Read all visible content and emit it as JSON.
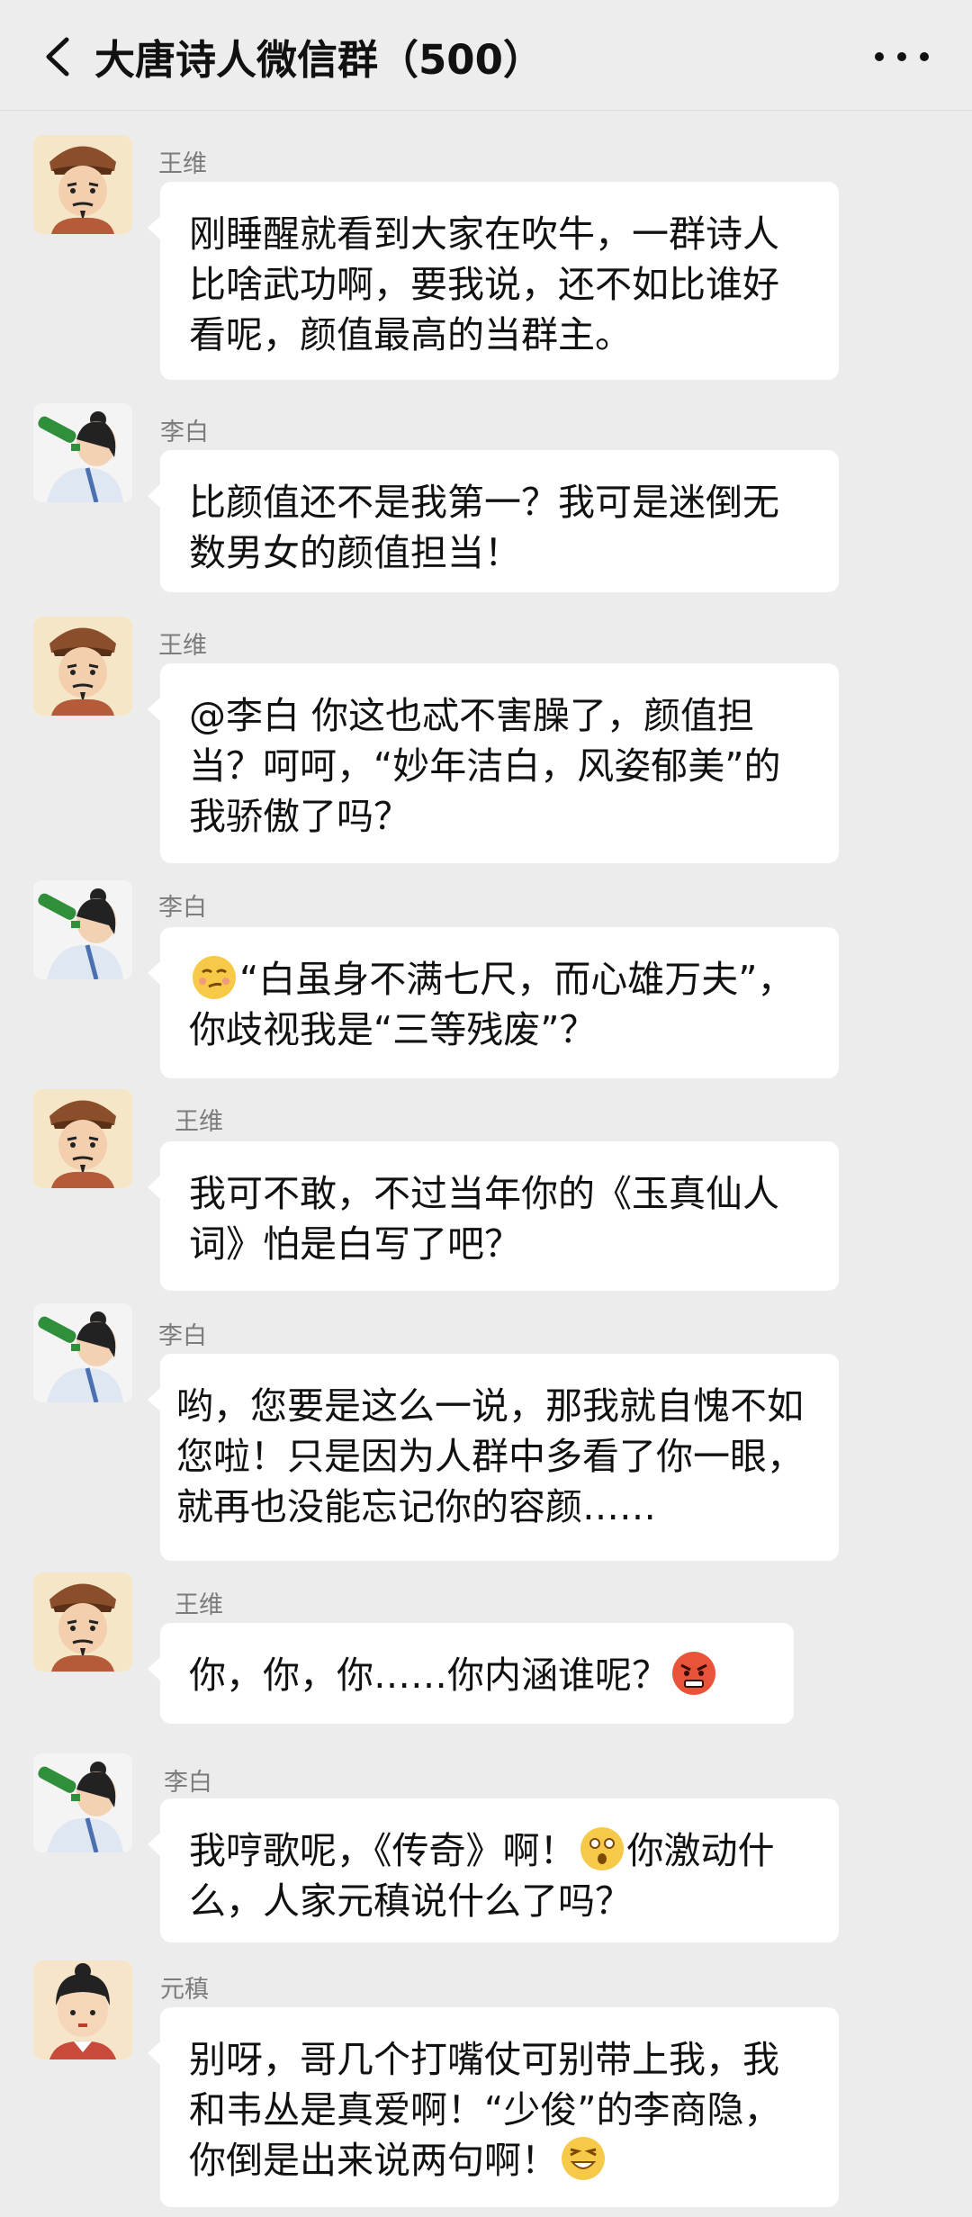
{
  "header": {
    "title": "大唐诗人微信群（500）"
  },
  "messages": [
    {
      "sender": "王维",
      "avatar": "wangwei-avatar",
      "text": "刚睡醒就看到大家在吹牛，一群诗人比啥武功啊，要我说，还不如比谁好看呢，颜值最高的当群主。"
    },
    {
      "sender": "李白",
      "avatar": "libai-avatar",
      "text": "比颜值还不是我第一？我可是迷倒无数男女的颜值担当！"
    },
    {
      "sender": "王维",
      "avatar": "wangwei-avatar",
      "text": "@李白 你这也忒不害臊了，颜值担当？呵呵，“妙年洁白，风姿郁美”的我骄傲了吗？"
    },
    {
      "sender": "李白",
      "avatar": "libai-avatar",
      "text": "“白虽身不满七尺，而心雄万夫”，你歧视我是“三等残废”？",
      "emoji": "smirk-face"
    },
    {
      "sender": "王维",
      "avatar": "wangwei-avatar",
      "text": "我可不敢，不过当年你的《玉真仙人词》怕是白写了吧？"
    },
    {
      "sender": "李白",
      "avatar": "libai-avatar",
      "text": "哟，您要是这么一说，那我就自愧不如您啦！只是因为人群中多看了你一眼，就再也没能忘记你的容颜……"
    },
    {
      "sender": "王维",
      "avatar": "wangwei-avatar",
      "text": "你，你，你……你内涵谁呢？",
      "emoji": "angry-face"
    },
    {
      "sender": "李白",
      "avatar": "libai-avatar",
      "text_a": "我哼歌呢，《传奇》啊！",
      "text_b": "你激动什么，人家元稹说什么了吗？",
      "emoji": "shocked-face"
    },
    {
      "sender": "元稹",
      "avatar": "yuanzhen-avatar",
      "text": "别呀，哥几个打嘴仗可别带上我，我和韦丛是真爱啊！“少俊”的李商隐，你倒是出来说两句啊！",
      "emoji": "grin-face"
    }
  ]
}
